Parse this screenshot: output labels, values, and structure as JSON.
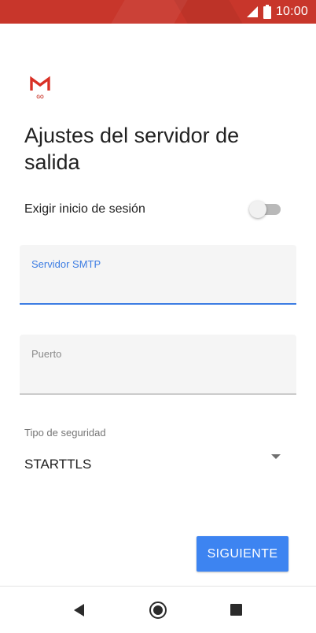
{
  "status_bar": {
    "time": "10:00",
    "icons": [
      "signal-icon",
      "battery-icon"
    ],
    "background_color": "#c8362b"
  },
  "app": {
    "logo": "gmail-go-logo",
    "logo_subtext": "GO"
  },
  "page": {
    "title": "Ajustes del servidor de salida"
  },
  "require_login": {
    "label": "Exigir inicio de sesión",
    "enabled": false
  },
  "smtp_server": {
    "label": "Servidor SMTP",
    "value": "",
    "focused": true
  },
  "port": {
    "label": "Puerto",
    "value": ""
  },
  "security": {
    "label": "Tipo de seguridad",
    "selected": "STARTTLS"
  },
  "actions": {
    "next_label": "SIGUIENTE"
  },
  "colors": {
    "accent": "#3d7de3",
    "button": "#3d84f1",
    "brand_red": "#c8362b"
  },
  "nav_bar": {
    "icons": [
      "back-icon",
      "home-icon",
      "recents-icon"
    ]
  }
}
